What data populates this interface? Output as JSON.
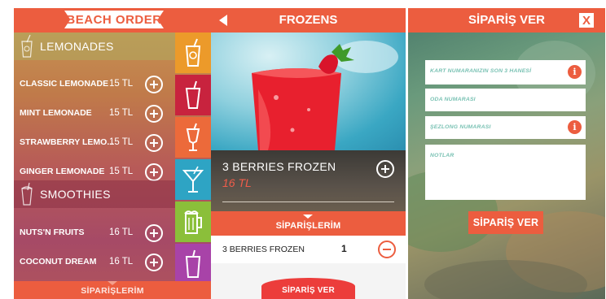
{
  "colors": {
    "brand": "#ec5d3f",
    "price_accent": "#f15d4a",
    "placeholder_text": "#7ac2b4",
    "tab_colors": [
      "#ec9a2a",
      "#c8233e",
      "#ec6a3a",
      "#2ea4c4",
      "#8bbf3a",
      "#a843a8"
    ]
  },
  "screen1": {
    "header_title": "BEACH ORDER",
    "categories": [
      {
        "label": "LEMONADES",
        "icon": "lemonade-glass-icon"
      },
      {
        "label": "SMOOTHIES",
        "icon": "smoothie-glass-icon"
      }
    ],
    "lemonade_items": [
      {
        "name": "CLASSIC LEMONADE",
        "price": "15 TL"
      },
      {
        "name": "MINT LEMONADE",
        "price": "15 TL"
      },
      {
        "name": "STRAWBERRY LEMO...",
        "price": "15 TL"
      },
      {
        "name": "GINGER LEMONADE",
        "price": "15 TL"
      }
    ],
    "smoothie_items": [
      {
        "name": "NUTS'N FRUITS",
        "price": "16 TL"
      },
      {
        "name": "COCONUT DREAM",
        "price": "16 TL"
      }
    ],
    "side_tab_icons": [
      "lemonade-glass-icon",
      "smoothie-glass-icon",
      "frozen-glass-icon",
      "cocktail-glass-icon",
      "beer-mug-icon",
      "soda-cup-icon"
    ],
    "footer_label": "SİPARİŞLERİM"
  },
  "screen2": {
    "header_title": "FROZENS",
    "product_name": "3 BERRIES FROZEN",
    "product_price": "16 TL",
    "orders_label": "SİPARİŞLERİM",
    "order_items": [
      {
        "name": "3 BERRIES FROZEN",
        "qty": "1"
      }
    ],
    "order_button": "SİPARİŞ VER"
  },
  "screen3": {
    "header_title": "SİPARİŞ VER",
    "close_label": "X",
    "fields": [
      {
        "placeholder": "KART NUMARANIZIN SON 3 HANESİ",
        "has_info": true
      },
      {
        "placeholder": "ODA NUMARASI",
        "has_info": false
      },
      {
        "placeholder": "ŞEZLONG NUMARASI",
        "has_info": true
      },
      {
        "placeholder": "NOTLAR",
        "has_info": false
      }
    ],
    "info_glyph": "i",
    "submit_label": "SİPARİŞ VER"
  }
}
